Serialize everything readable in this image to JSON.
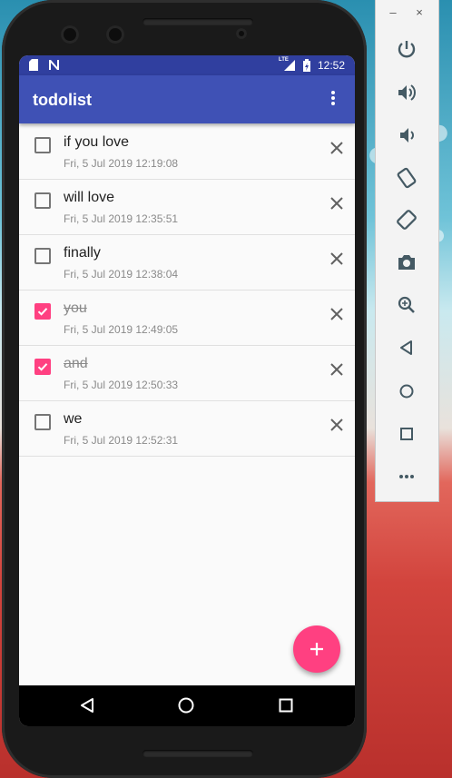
{
  "status_bar": {
    "time": "12:52",
    "network_label": "LTE"
  },
  "app_bar": {
    "title": "todolist",
    "overflow_icon": "more-vert-icon"
  },
  "todos": [
    {
      "title": "if you love",
      "date": "Fri, 5 Jul 2019 12:19:08",
      "checked": false
    },
    {
      "title": "will love",
      "date": "Fri, 5 Jul 2019 12:35:51",
      "checked": false
    },
    {
      "title": "finally",
      "date": "Fri, 5 Jul 2019 12:38:04",
      "checked": false
    },
    {
      "title": "you",
      "date": "Fri, 5 Jul 2019 12:49:05",
      "checked": true
    },
    {
      "title": "and",
      "date": "Fri, 5 Jul 2019 12:50:33",
      "checked": true
    },
    {
      "title": "we",
      "date": "Fri, 5 Jul 2019 12:52:31",
      "checked": false
    }
  ],
  "fab": {
    "icon": "plus-icon"
  },
  "nav": {
    "back_icon": "back-triangle-icon",
    "home_icon": "home-circle-icon",
    "recents_icon": "recents-square-icon"
  },
  "emulator_panel": {
    "window_controls": [
      "–",
      "×"
    ],
    "buttons": [
      "power-icon",
      "volume-up-icon",
      "volume-down-icon",
      "rotate-left-icon",
      "rotate-right-icon",
      "camera-icon",
      "zoom-icon",
      "back-icon",
      "home-icon",
      "overview-icon",
      "more-icon"
    ]
  },
  "colors": {
    "primary": "#3f51b5",
    "primary_dark": "#303f9f",
    "accent": "#ff4081"
  }
}
